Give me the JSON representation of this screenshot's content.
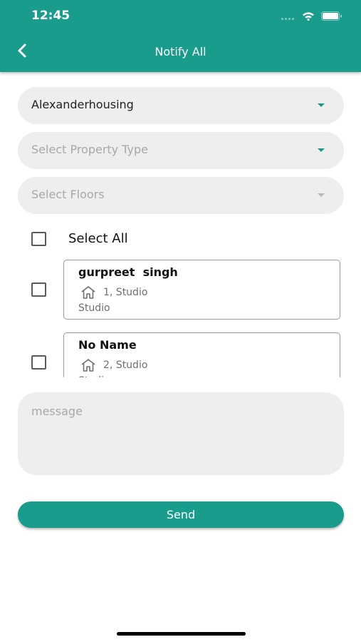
{
  "status_bar": {
    "time": "12:45"
  },
  "header": {
    "title": "Notify All",
    "back_icon": "chevron-left-icon"
  },
  "filters": {
    "property": {
      "value": "Alexanderhousing"
    },
    "property_type": {
      "placeholder": "Select Property Type"
    },
    "floors": {
      "placeholder": "Select Floors"
    }
  },
  "select_all": {
    "label": "Select All",
    "checked": false
  },
  "residents": [
    {
      "name": "gurpreet  singh",
      "unit": "1, Studio",
      "type": "Studio",
      "checked": false
    },
    {
      "name": "No Name",
      "unit": "2, Studio",
      "type": "Studio",
      "checked": false
    }
  ],
  "message": {
    "placeholder": "message"
  },
  "send_button": {
    "label": "Send"
  },
  "colors": {
    "accent": "#199c8c",
    "field_bg": "#eeeeee"
  }
}
